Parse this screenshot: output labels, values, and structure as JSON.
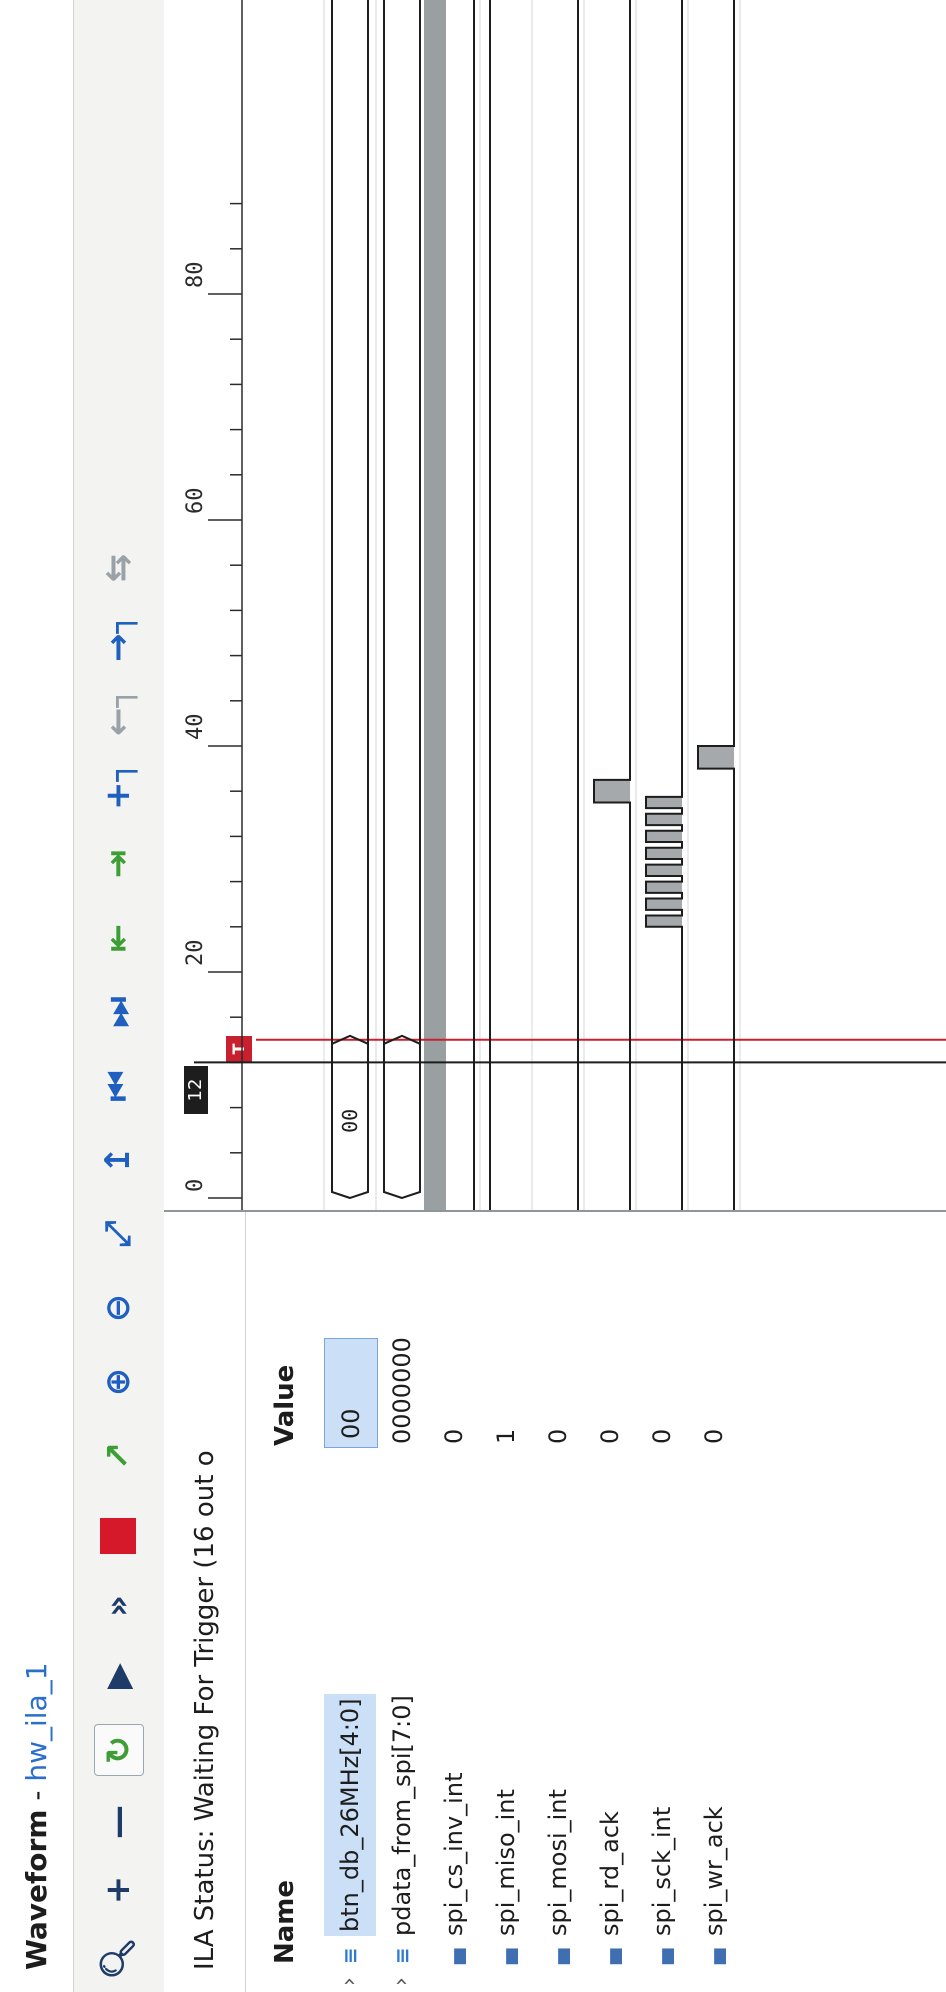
{
  "window": {
    "app": "Waveform",
    "separator": " - ",
    "instance": "hw_ila_1"
  },
  "toolbar": {
    "buttons": [
      "search-icon",
      "zoom-add-icon",
      "remove-icon",
      "refresh-icon",
      "run-icon",
      "run-immediate-icon",
      "stop-icon",
      "export-icon",
      "zoom-in-icon",
      "zoom-out-icon",
      "zoom-fit-icon",
      "marker-icon",
      "go-first-icon",
      "go-last-icon",
      "prev-transition-icon",
      "next-transition-icon",
      "add-marker-icon",
      "prev-marker-icon",
      "next-marker-icon",
      "swap-cursor-icon"
    ]
  },
  "status": {
    "text": "ILA Status: Waiting For Trigger (16 out o"
  },
  "columns": {
    "name": "Name",
    "value": "Value"
  },
  "signals": [
    {
      "name": "btn_db_26MHz[4:0]",
      "value": "00",
      "type": "bus",
      "expandable": true,
      "selected": true
    },
    {
      "name": "pdata_from_spi[7:0]",
      "value": "0000000",
      "type": "bus",
      "expandable": true,
      "selected": false
    },
    {
      "name": "spi_cs_inv_int",
      "value": "0",
      "type": "bit",
      "expandable": false,
      "selected": false
    },
    {
      "name": "spi_miso_int",
      "value": "1",
      "type": "bit",
      "expandable": false,
      "selected": false
    },
    {
      "name": "spi_mosi_int",
      "value": "0",
      "type": "bit",
      "expandable": false,
      "selected": false
    },
    {
      "name": "spi_rd_ack",
      "value": "0",
      "type": "bit",
      "expandable": false,
      "selected": false
    },
    {
      "name": "spi_sck_int",
      "value": "0",
      "type": "bit",
      "expandable": false,
      "selected": false
    },
    {
      "name": "spi_wr_ack",
      "value": "0",
      "type": "bit",
      "expandable": false,
      "selected": false
    }
  ],
  "waveform": {
    "cursor_value": "12",
    "trigger_marker": "T",
    "timeline": {
      "min": 0,
      "max": 90,
      "major_ticks": [
        0,
        20,
        40,
        60,
        80
      ]
    },
    "cursor_sample": 12,
    "trigger_sample": 14,
    "bus_labels": [
      {
        "signal": "btn_db_26MHz[4:0]",
        "text": "00"
      }
    ],
    "digital": {
      "spi_rd_ack": [
        [
          35,
          37
        ]
      ],
      "spi_sck_int": [
        [
          24,
          25
        ],
        [
          25.5,
          26.5
        ],
        [
          27,
          28
        ],
        [
          28.5,
          29.5
        ],
        [
          30,
          31
        ],
        [
          31.5,
          32.5
        ],
        [
          33,
          34
        ],
        [
          34.5,
          35.5
        ]
      ],
      "spi_wr_ack": [
        [
          38,
          40
        ]
      ]
    }
  }
}
